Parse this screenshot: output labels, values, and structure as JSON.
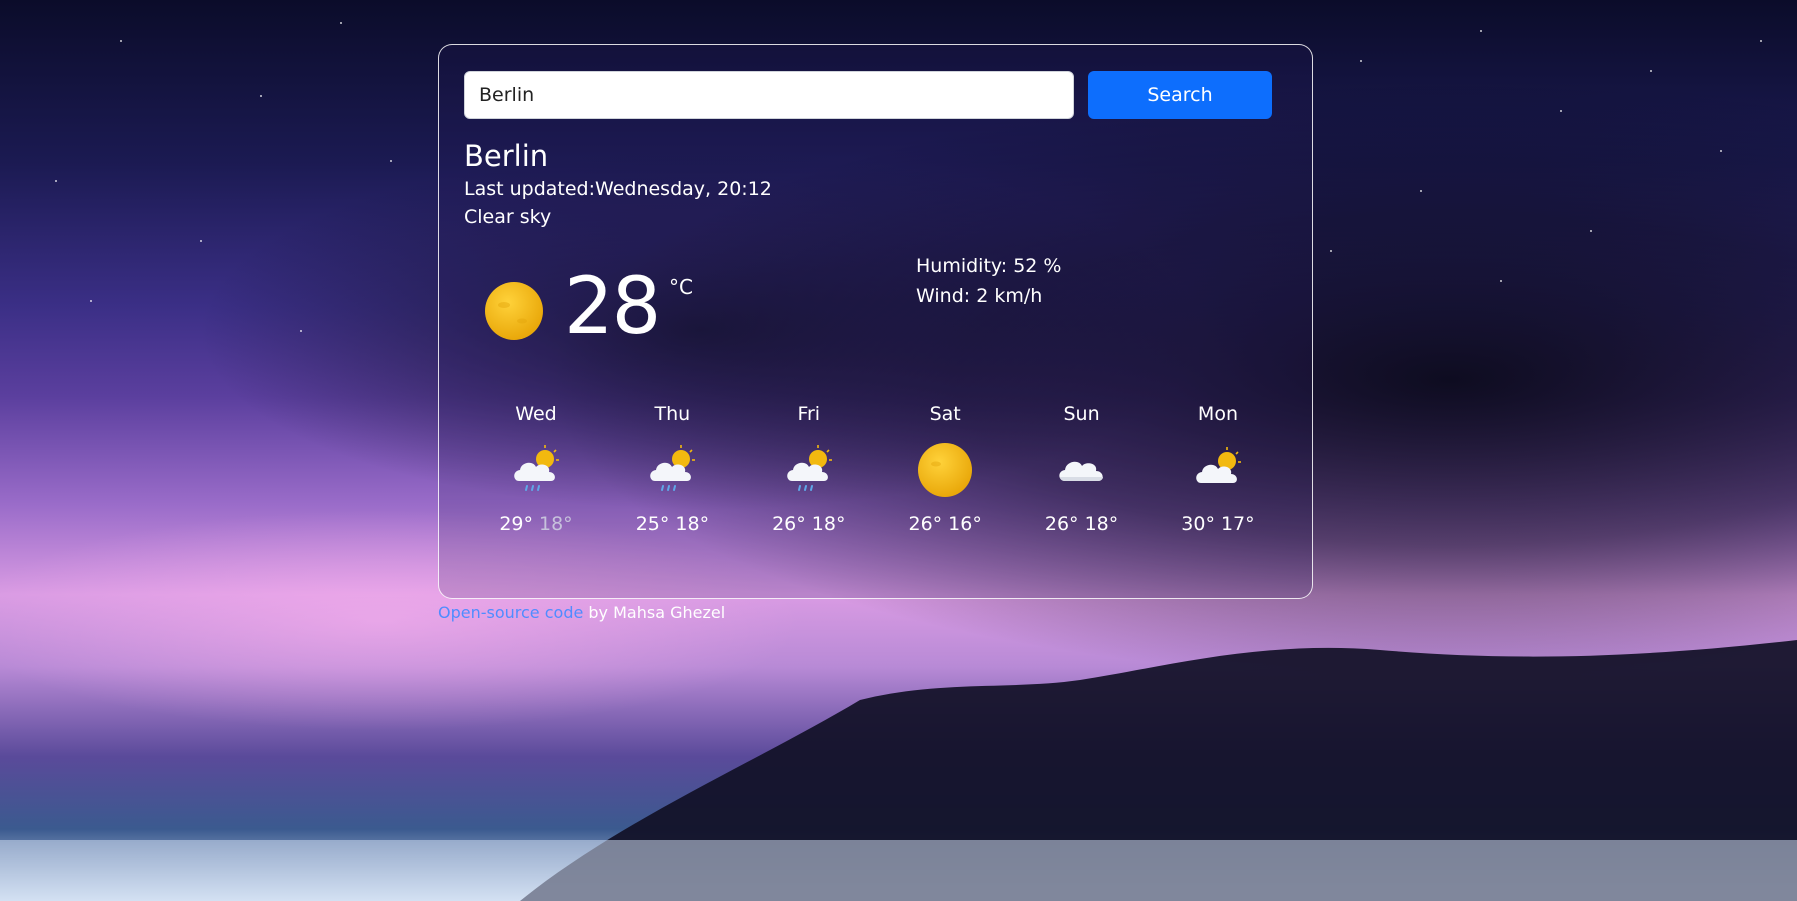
{
  "search": {
    "value": "Berlin",
    "button_label": "Search"
  },
  "current": {
    "city": "Berlin",
    "updated_label": "Last updated:",
    "updated_value": "Wednesday, 20:12",
    "description": "Clear sky",
    "icon": "sun-icon",
    "temperature": "28",
    "unit": "°C",
    "humidity_label": "Humidity:",
    "humidity_value": "52 %",
    "wind_label": "Wind:",
    "wind_value": "2 km/h"
  },
  "forecast": [
    {
      "day": "Wed",
      "icon": "cloud-sun-rain-icon",
      "max": "29°",
      "min": "18°"
    },
    {
      "day": "Thu",
      "icon": "cloud-sun-rain-icon",
      "max": "25°",
      "min": "18°"
    },
    {
      "day": "Fri",
      "icon": "cloud-sun-rain-icon",
      "max": "26°",
      "min": "18°"
    },
    {
      "day": "Sat",
      "icon": "sun-icon",
      "max": "26°",
      "min": "16°"
    },
    {
      "day": "Sun",
      "icon": "cloud-icon",
      "max": "26°",
      "min": "18°"
    },
    {
      "day": "Mon",
      "icon": "cloud-sun-icon",
      "max": "30°",
      "min": "17°"
    }
  ],
  "footer": {
    "link_text": "Open-source code",
    "suffix": " by Mahsa Ghezel"
  },
  "colors": {
    "accent": "#0d6efd",
    "link": "#4f8cff",
    "sun": "#f2b90f"
  }
}
